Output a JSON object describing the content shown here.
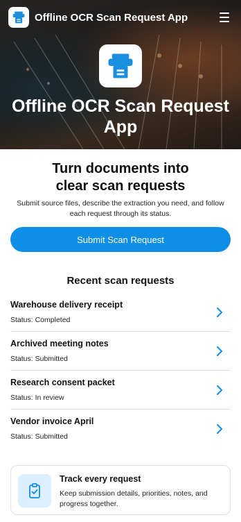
{
  "header": {
    "app_title": "Offline OCR Scan Request App",
    "menu_icon": "hamburger-menu-icon",
    "logo_icon": "scanner-icon"
  },
  "hero": {
    "title": "Offline OCR Scan Request App",
    "background": "mixing-console-photo"
  },
  "intro": {
    "title": "Turn documents into clear scan requests",
    "subtitle": "Submit source files, describe the extraction you need, and follow each request through its status."
  },
  "actions": {
    "submit_label": "Submit Scan Request"
  },
  "recent": {
    "heading": "Recent scan requests",
    "items": [
      {
        "title": "Warehouse delivery receipt",
        "status": "Status: Completed"
      },
      {
        "title": "Archived meeting notes",
        "status": "Status: Submitted"
      },
      {
        "title": "Research consent packet",
        "status": "Status: In review"
      },
      {
        "title": "Vendor invoice April",
        "status": "Status: Submitted"
      }
    ]
  },
  "track": {
    "title": "Track every request",
    "description": "Keep submission details, priorities, notes, and progress together.",
    "icon": "clipboard-check-icon"
  },
  "colors": {
    "accent": "#0f8ee6",
    "icon_bg": "#dcefff"
  }
}
